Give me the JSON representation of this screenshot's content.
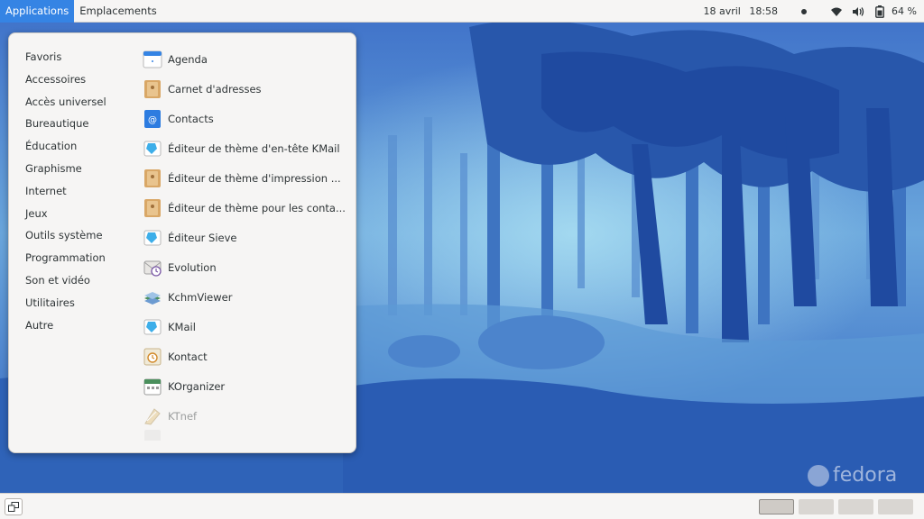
{
  "top_bar": {
    "applications_label": "Applications",
    "places_label": "Emplacements",
    "date": "18 avril",
    "time": "18:58",
    "battery_percent": "64 %"
  },
  "menu": {
    "categories": [
      {
        "label": "Favoris"
      },
      {
        "label": "Accessoires"
      },
      {
        "label": "Accès universel"
      },
      {
        "label": "Bureautique"
      },
      {
        "label": "Éducation"
      },
      {
        "label": "Graphisme"
      },
      {
        "label": "Internet"
      },
      {
        "label": "Jeux"
      },
      {
        "label": "Outils système"
      },
      {
        "label": "Programmation"
      },
      {
        "label": "Son et vidéo"
      },
      {
        "label": "Utilitaires"
      },
      {
        "label": "Autre"
      }
    ],
    "apps": [
      {
        "label": "Agenda",
        "icon": "calendar-icon"
      },
      {
        "label": "Carnet d'adresses",
        "icon": "address-book-icon"
      },
      {
        "label": "Contacts",
        "icon": "contacts-icon"
      },
      {
        "label": "Éditeur de thème d'en-tête KMail",
        "icon": "kmail-theme-icon"
      },
      {
        "label": "Éditeur de thème d'impression ...",
        "icon": "print-theme-icon"
      },
      {
        "label": "Éditeur de thème pour les conta...",
        "icon": "contact-theme-icon"
      },
      {
        "label": "Éditeur Sieve",
        "icon": "sieve-editor-icon"
      },
      {
        "label": "Evolution",
        "icon": "evolution-icon"
      },
      {
        "label": "KchmViewer",
        "icon": "kchmviewer-icon"
      },
      {
        "label": "KMail",
        "icon": "kmail-icon"
      },
      {
        "label": "Kontact",
        "icon": "kontact-icon"
      },
      {
        "label": "KOrganizer",
        "icon": "korganizer-icon"
      },
      {
        "label": "KTnef",
        "icon": "ktnef-icon"
      }
    ]
  },
  "watermark": "fedora",
  "workspaces": {
    "count": 4,
    "active_index": 0
  },
  "colors": {
    "accent": "#3584e4",
    "panel_bg": "#f6f5f4",
    "wallpaper_dark": "#1f4aa0",
    "wallpaper_light": "#5fb7e0"
  }
}
